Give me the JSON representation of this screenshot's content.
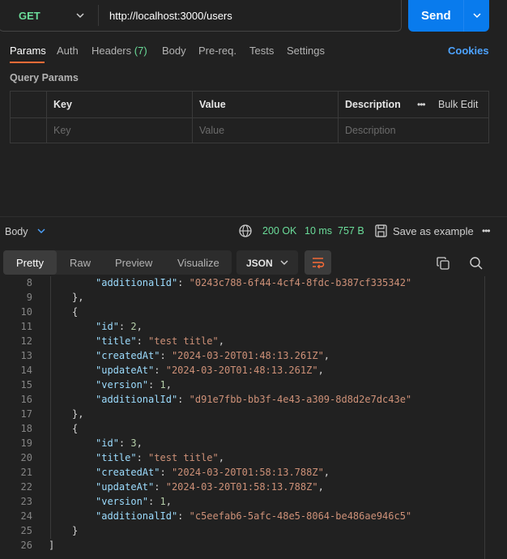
{
  "request": {
    "method": "GET",
    "url": "http://localhost:3000/users",
    "send_label": "Send"
  },
  "request_tabs": {
    "params": "Params",
    "auth": "Auth",
    "headers": "Headers",
    "headers_count": "(7)",
    "body": "Body",
    "prereq": "Pre-req.",
    "tests": "Tests",
    "settings": "Settings",
    "cookies": "Cookies"
  },
  "query_params": {
    "title": "Query Params",
    "columns": {
      "key": "Key",
      "value": "Value",
      "description": "Description",
      "bulk_edit": "Bulk Edit",
      "more": "•••"
    },
    "placeholders": {
      "key": "Key",
      "value": "Value",
      "description": "Description"
    }
  },
  "response": {
    "body_label": "Body",
    "status": "200 OK",
    "time": "10 ms",
    "size": "757 B",
    "save_example": "Save as example",
    "more": "•••",
    "view_tabs": {
      "pretty": "Pretty",
      "raw": "Raw",
      "preview": "Preview",
      "visualize": "Visualize"
    },
    "format": "JSON"
  },
  "code": {
    "lines": [
      {
        "n": "8",
        "key": "additionalId",
        "value": "\"0243c788-6f44-4cf4-8fdc-b387cf335342\"",
        "kind": "kv-str-last"
      },
      {
        "n": "9",
        "text": "},",
        "kind": "punct",
        "indent": 1
      },
      {
        "n": "10",
        "text": "{",
        "kind": "punct",
        "indent": 1
      },
      {
        "n": "11",
        "key": "id",
        "value": "2",
        "kind": "kv-num"
      },
      {
        "n": "12",
        "key": "title",
        "value": "\"test title\"",
        "kind": "kv-str"
      },
      {
        "n": "13",
        "key": "createdAt",
        "value": "\"2024-03-20T01:48:13.261Z\"",
        "kind": "kv-str"
      },
      {
        "n": "14",
        "key": "updateAt",
        "value": "\"2024-03-20T01:48:13.261Z\"",
        "kind": "kv-str"
      },
      {
        "n": "15",
        "key": "version",
        "value": "1",
        "kind": "kv-num"
      },
      {
        "n": "16",
        "key": "additionalId",
        "value": "\"d91e7fbb-bb3f-4e43-a309-8d8d2e7dc43e\"",
        "kind": "kv-str-last"
      },
      {
        "n": "17",
        "text": "},",
        "kind": "punct",
        "indent": 1
      },
      {
        "n": "18",
        "text": "{",
        "kind": "punct",
        "indent": 1
      },
      {
        "n": "19",
        "key": "id",
        "value": "3",
        "kind": "kv-num"
      },
      {
        "n": "20",
        "key": "title",
        "value": "\"test title\"",
        "kind": "kv-str"
      },
      {
        "n": "21",
        "key": "createdAt",
        "value": "\"2024-03-20T01:58:13.788Z\"",
        "kind": "kv-str"
      },
      {
        "n": "22",
        "key": "updateAt",
        "value": "\"2024-03-20T01:58:13.788Z\"",
        "kind": "kv-str"
      },
      {
        "n": "23",
        "key": "version",
        "value": "1",
        "kind": "kv-num"
      },
      {
        "n": "24",
        "key": "additionalId",
        "value": "\"c5eefab6-5afc-48e5-8064-be486ae946c5\"",
        "kind": "kv-str-last"
      },
      {
        "n": "25",
        "text": "}",
        "kind": "punct",
        "indent": 1
      },
      {
        "n": "26",
        "text": "]",
        "kind": "punct",
        "indent": 0
      }
    ]
  },
  "colors": {
    "accent": "#ff6c37",
    "send": "#097bed",
    "success": "#6bdd9a",
    "link": "#4da3ff",
    "background": "#212121"
  },
  "icons": [
    "chevron-down-icon",
    "globe-icon",
    "save-icon",
    "more-icon",
    "wrap-lines-icon",
    "copy-icon",
    "search-icon"
  ]
}
